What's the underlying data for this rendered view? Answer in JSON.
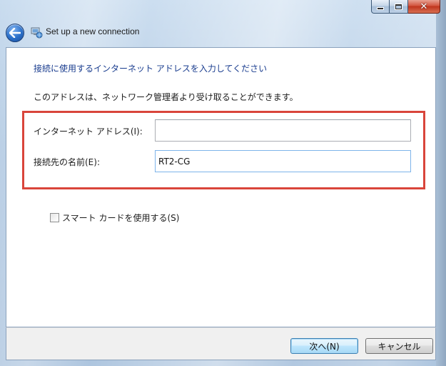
{
  "window": {
    "title": "Set up a new connection",
    "icons": {
      "back": "back-arrow-icon",
      "title": "network-connection-icon",
      "minimize": "minimize-icon",
      "maximize": "maximize-icon",
      "close": "close-icon"
    }
  },
  "dialog": {
    "heading": "接続に使用するインターネット アドレスを入力してください",
    "description": "このアドレスは、ネットワーク管理者より受け取ることができます。",
    "fields": {
      "address": {
        "label": "インターネット アドレス(I):",
        "value": ""
      },
      "name": {
        "label": "接続先の名前(E):",
        "value": "RT2-CG"
      }
    },
    "smart_card": {
      "label": "スマート カードを使用する(S)",
      "checked": false
    }
  },
  "buttons": {
    "next": "次へ(N)",
    "cancel": "キャンセル"
  },
  "colors": {
    "highlight": "#d9453b",
    "heading": "#1a3d8f"
  }
}
